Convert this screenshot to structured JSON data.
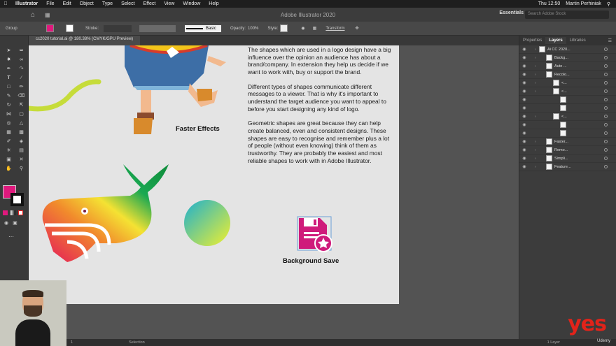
{
  "menubar": {
    "items": [
      "Illustrator",
      "File",
      "Edit",
      "Object",
      "Type",
      "Select",
      "Effect",
      "View",
      "Window",
      "Help"
    ],
    "user": "Martin Perhiniak",
    "time": "Thu 12:50"
  },
  "appbar": {
    "title": "Adobe Illustrator 2020",
    "workspace": "Essentials",
    "search_placeholder": "Search Adobe Stock"
  },
  "control": {
    "selection": "Group",
    "stroke_label": "Stroke:",
    "stroke_style": "Basic",
    "opacity_label": "Opacity:",
    "opacity_value": "100%",
    "style_label": "Style:",
    "transform": "Transform",
    "fill_color": "#e0197d"
  },
  "document": {
    "tab": "cc2020 tutorial.ai @ 180.38% (CMYK/GPU Preview)"
  },
  "artboard": {
    "paragraphs": [
      "The shapes which are used in a logo design have a big influence over the opinion an audience has about a brand/company. In extension they help us decide if we want to work with, buy or support the brand.",
      "Different types of shapes communicate different messages to a viewer. That is why it's important to understand the target audience you want to appeal to before you start designing any kind of logo.",
      "Geometric shapes are great because they can help create balanced, even and consistent designs. These shapes are easy to recognise and remember plus a lot of people (without even knowing) think of them as trustworthy. They are probably the easiest and most reliable shapes to work with in Adobe Illustrator."
    ],
    "label_faster": "Faster Effects",
    "label_bg": "Background Save"
  },
  "panel": {
    "tabs": [
      "Properties",
      "Layers",
      "Libraries"
    ],
    "layers": [
      {
        "name": "Ai CC 2020...",
        "indent": 0
      },
      {
        "name": "Backg...",
        "indent": 1
      },
      {
        "name": "Auto ...",
        "indent": 1
      },
      {
        "name": "Recolo...",
        "indent": 1
      },
      {
        "name": "<...",
        "indent": 2
      },
      {
        "name": "<...",
        "indent": 2
      },
      {
        "name": "",
        "indent": 3
      },
      {
        "name": "",
        "indent": 3
      },
      {
        "name": "<...",
        "indent": 2
      },
      {
        "name": "",
        "indent": 3
      },
      {
        "name": "",
        "indent": 3
      },
      {
        "name": "Faster...",
        "indent": 1
      },
      {
        "name": "Remo...",
        "indent": 1
      },
      {
        "name": "Simpli...",
        "indent": 1
      },
      {
        "name": "Feature...",
        "indent": 1
      }
    ],
    "footer": "1 Layer"
  },
  "status": {
    "zoom": "1",
    "tool": "Selection"
  },
  "branding": {
    "logo": "yes",
    "platform": "Udemy"
  }
}
